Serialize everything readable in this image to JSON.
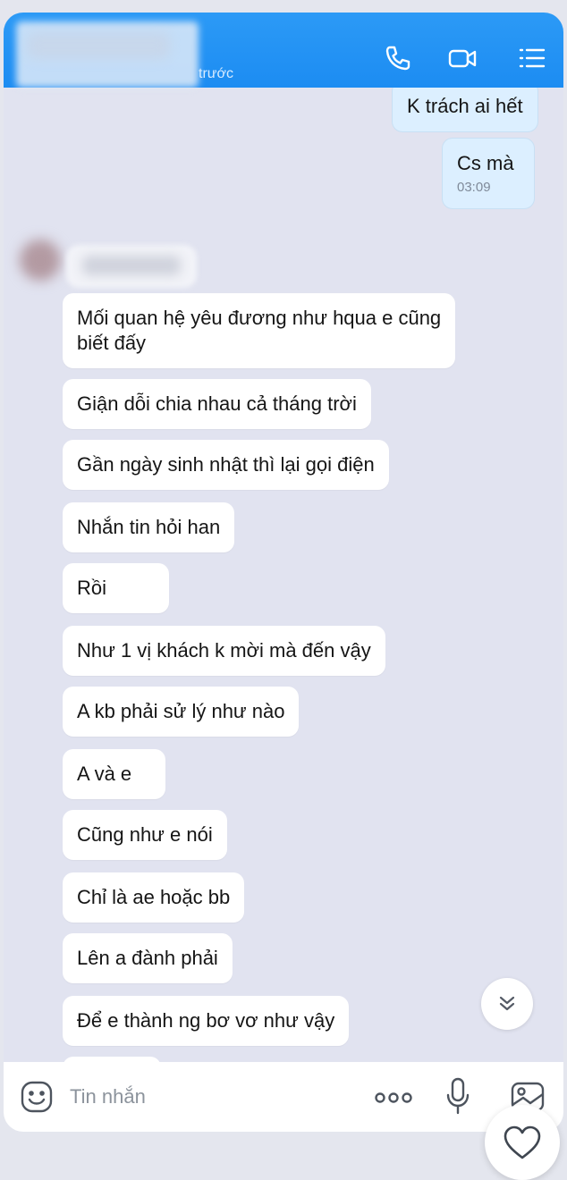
{
  "header": {
    "subtitle_visible": "trước"
  },
  "messages": {
    "outgoing": [
      {
        "text": "K trách ai hết"
      },
      {
        "text": "Cs mà",
        "time": "03:09"
      }
    ],
    "incoming": [
      {
        "line1": "Mối quan hệ yêu đương như hqua e cũng",
        "line2": "biết đấy"
      },
      {
        "text": "Giận dỗi chia nhau cả tháng trời"
      },
      {
        "text": "Gần ngày sinh nhật thì lại gọi điện"
      },
      {
        "text": "Nhắn tin hỏi han"
      },
      {
        "text": "Rồi"
      },
      {
        "text": "Như 1 vị khách k mời mà đến vậy"
      },
      {
        "text": "A kb phải sử lý như nào"
      },
      {
        "text": "A và e"
      },
      {
        "text": "Cũng như e nói"
      },
      {
        "text": "Chỉ là ae hoặc bb"
      },
      {
        "text": "Lên a đành phải"
      },
      {
        "text": "Để e thành ng bơ vơ như vậy"
      }
    ]
  },
  "input": {
    "placeholder": "Tin nhắn"
  },
  "icons": {
    "call": "phone-icon",
    "video": "video-camera-icon",
    "menu": "list-menu-icon",
    "emoji": "emoji-icon",
    "more": "more-dots-icon",
    "mic": "microphone-icon",
    "image": "image-icon",
    "scroll": "double-chevron-down-icon",
    "heart": "heart-icon"
  },
  "colors": {
    "header": "#1c8cf2",
    "background": "#e1e3f0",
    "outgoing_bubble": "#dcefff",
    "incoming_bubble": "#ffffff"
  }
}
